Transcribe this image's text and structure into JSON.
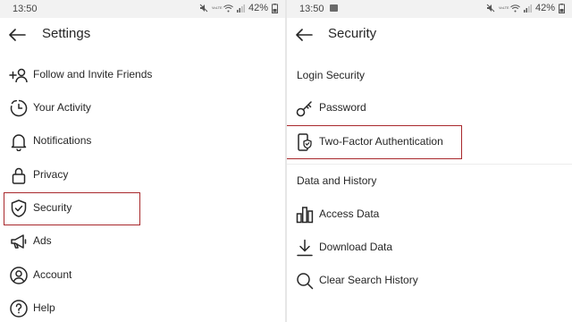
{
  "status_bar": {
    "time": "13:50",
    "battery": "42%",
    "net_label": "VoLTE"
  },
  "settings_panel": {
    "title": "Settings",
    "items": [
      {
        "label": "Follow and Invite Friends",
        "icon": "add-person-icon"
      },
      {
        "label": "Your Activity",
        "icon": "activity-clock-icon"
      },
      {
        "label": "Notifications",
        "icon": "bell-icon"
      },
      {
        "label": "Privacy",
        "icon": "lock-icon"
      },
      {
        "label": "Security",
        "icon": "shield-check-icon"
      },
      {
        "label": "Ads",
        "icon": "megaphone-icon"
      },
      {
        "label": "Account",
        "icon": "account-circle-icon"
      },
      {
        "label": "Help",
        "icon": "help-circle-icon"
      }
    ],
    "highlighted_item": "Security"
  },
  "security_panel": {
    "title": "Security",
    "login_section": {
      "header": "Login Security",
      "items": [
        {
          "label": "Password",
          "icon": "key-icon"
        },
        {
          "label": "Two-Factor Authentication",
          "icon": "phone-shield-icon"
        }
      ]
    },
    "data_section": {
      "header": "Data and History",
      "items": [
        {
          "label": "Access Data",
          "icon": "bar-chart-icon"
        },
        {
          "label": "Download Data",
          "icon": "download-icon"
        },
        {
          "label": "Clear Search History",
          "icon": "search-icon"
        }
      ]
    },
    "highlighted_item": "Two-Factor Authentication"
  },
  "colors": {
    "highlight_border": "#a8282c",
    "text": "#262626",
    "status_bar_bg": "#f2f2f2"
  }
}
